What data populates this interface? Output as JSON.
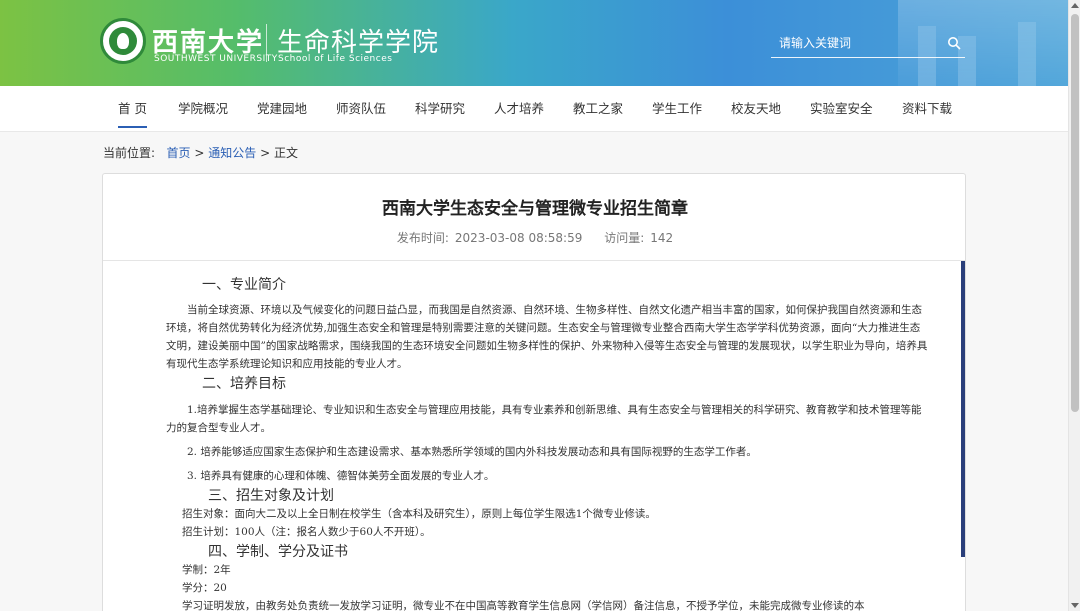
{
  "header": {
    "university_cn": "西南大学",
    "university_en": "SOUTHWEST UNIVERSITY",
    "school_cn": "生命科学学院",
    "school_en": "School of Life Sciences",
    "search_placeholder": "请输入关键词"
  },
  "nav": [
    "首 页",
    "学院概况",
    "党建园地",
    "师资队伍",
    "科学研究",
    "人才培养",
    "教工之家",
    "学生工作",
    "校友天地",
    "实验室安全",
    "资料下载"
  ],
  "breadcrumb": {
    "label": "当前位置:",
    "home": "首页",
    "sep1": ">",
    "section": "通知公告",
    "sep2": ">",
    "current": "正文"
  },
  "article": {
    "title": "西南大学生态安全与管理微专业招生简章",
    "publish_label": "发布时间:",
    "publish_time": "2023-03-08 08:58:59",
    "views_label": "访问量:",
    "views": "142",
    "h1": "一、专业简介",
    "p1": "当前全球资源、环境以及气候变化的问题日益凸显，而我国是自然资源、自然环境、生物多样性、自然文化遗产相当丰富的国家，如何保护我国自然资源和生态环境，将自然优势转化为经济优势,加强生态安全和管理是特别需要注意的关键问题。生态安全与管理微专业整合西南大学生态学学科优势资源，面向“大力推进生态文明，建设美丽中国”的国家战略需求，围绕我国的生态环境安全问题如生物多样性的保护、外来物种入侵等生态安全与管理的发展现状，以学生职业为导向，培养具有现代生态学系统理论知识和应用技能的专业人才。",
    "h2": "二、培养目标",
    "g1": "1.培养掌握生态学基础理论、专业知识和生态安全与管理应用技能，具有专业素养和创新思维、具有生态安全与管理相关的科学研究、教育教学和技术管理等能力的复合型专业人才。",
    "g2": "2. 培养能够适应国家生态保护和生态建设需求、基本熟悉所学领域的国内外科技发展动态和具有国际视野的生态学工作者。",
    "g3": "3. 培养具有健康的心理和体魄、德智体美劳全面发展的专业人才。",
    "h3": "三、招生对象及计划",
    "s1": "招生对象：面向大二及以上全日制在校学生（含本科及研究生），原则上每位学生限选1个微专业修读。",
    "s2": "招生计划：100人（注：报名人数少于60人不开班）。",
    "h4": "四、学制、学分及证书",
    "d1": "学制：2年",
    "d2": "学分：20",
    "d3": "学习证明发放，由教务处负责统一发放学习证明，微专业不在中国高等教育学生信息网（学信网）备注信息，不授予学位，未能完成微专业修读的本"
  }
}
